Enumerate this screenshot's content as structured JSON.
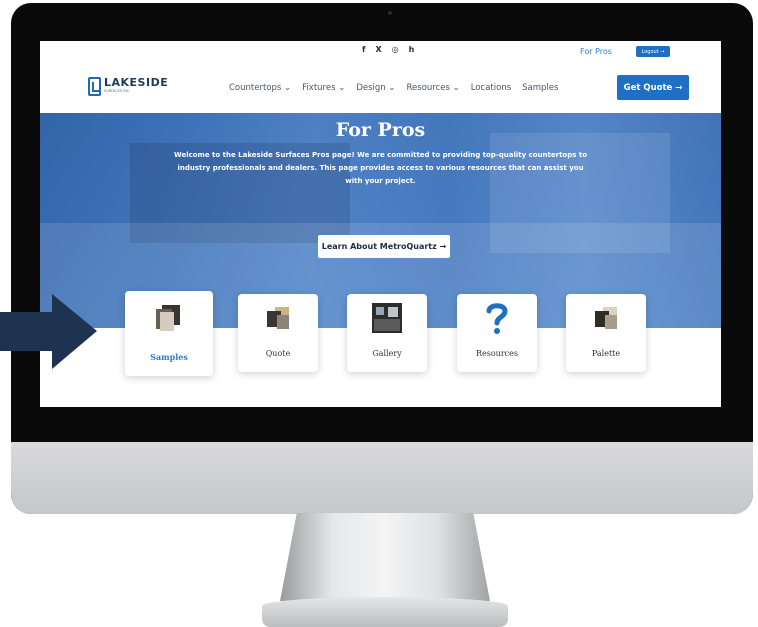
{
  "topbar": {
    "social_icons": [
      "facebook-icon",
      "x-icon",
      "instagram-icon",
      "houzz-icon"
    ],
    "social_glyphs": [
      "f",
      "X",
      "◎",
      "h"
    ],
    "for_pros_link": "For Pros",
    "logout": "Logout →"
  },
  "brand": {
    "name": "LAKESIDE",
    "sub": "SURFACES INC."
  },
  "nav": [
    "Countertops ⌄",
    "Fixtures ⌄",
    "Design ⌄",
    "Resources ⌄",
    "Locations",
    "Samples"
  ],
  "cta": {
    "get_quote": "Get Quote →"
  },
  "hero": {
    "title": "For Pros",
    "text": "Welcome to the Lakeside Surfaces Pros page! We are committed to providing top-quality countertops to industry professionals and dealers. This page provides access to various resources that can assist you with your project.",
    "button": "Learn About MetroQuartz →"
  },
  "cards": [
    {
      "label": "Samples",
      "icon": "stone-samples-icon"
    },
    {
      "label": "Quote",
      "icon": "stone-tiles-icon"
    },
    {
      "label": "Gallery",
      "icon": "kitchen-photo-icon"
    },
    {
      "label": "Resources",
      "icon": "question-mark-icon"
    },
    {
      "label": "Palette",
      "icon": "stone-palette-icon"
    }
  ],
  "colors": {
    "brand_blue": "#1f6fc4",
    "link_blue": "#2b7cd3",
    "arrow_navy": "#1d3350"
  }
}
